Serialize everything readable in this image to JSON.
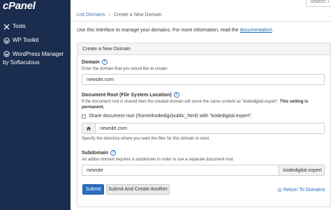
{
  "sidebar": {
    "logo": "cPanel",
    "items": [
      {
        "label": "Tools"
      },
      {
        "label": "WP Toolkit"
      },
      {
        "label": "WordPress Manager",
        "sublabel": "by Softaculous"
      }
    ]
  },
  "header": {
    "search_placeholder": "Search T"
  },
  "breadcrumb": {
    "parent": "List Domains",
    "separator": "›",
    "current": "Create a New Domain"
  },
  "intro": {
    "text": "Use this interface to manage your domains. For more information, read the",
    "link": "documentation",
    "end": "."
  },
  "panel": {
    "title": "Create a New Domain",
    "domain": {
      "label": "Domain",
      "hint": "Enter the domain that you would like to create:",
      "value": "newsite.com"
    },
    "docroot": {
      "label": "Document Root (File System Location)",
      "hint_line1": "If the document root is shared then the created domain will serve the same content as “kodedigital.expert”.",
      "hint_bold": "This setting is",
      "hint_line2_bold": "permanent.",
      "share_label": "Share document root (/home/kodedigi/public_html) with “kodedigital.expert”.",
      "share_checked": false,
      "value": "newsite.com",
      "hint_below": "Specify the directory where you want the files for this domain to exist."
    },
    "subdomain": {
      "label": "Subdomain",
      "hint": "An addon domain requires a subdomain in order to use a separate document root.",
      "value": "newsite",
      "suffix": ".kodedigital.expert"
    },
    "buttons": {
      "submit": "Submit",
      "submit_create_another": "Submit And Create Another"
    },
    "return_link": "Return To Domains"
  },
  "icons": {
    "tools": "tools-icon",
    "wp_toolkit": "wordpress-icon",
    "wp_manager": "wordpress-icon",
    "help": "help-icon",
    "home": "home-icon",
    "return": "arrow-left-icon"
  },
  "colors": {
    "sidebar_bg": "#1a2d4e",
    "primary_button": "#2b6dbf",
    "link": "#1d6bb6"
  }
}
